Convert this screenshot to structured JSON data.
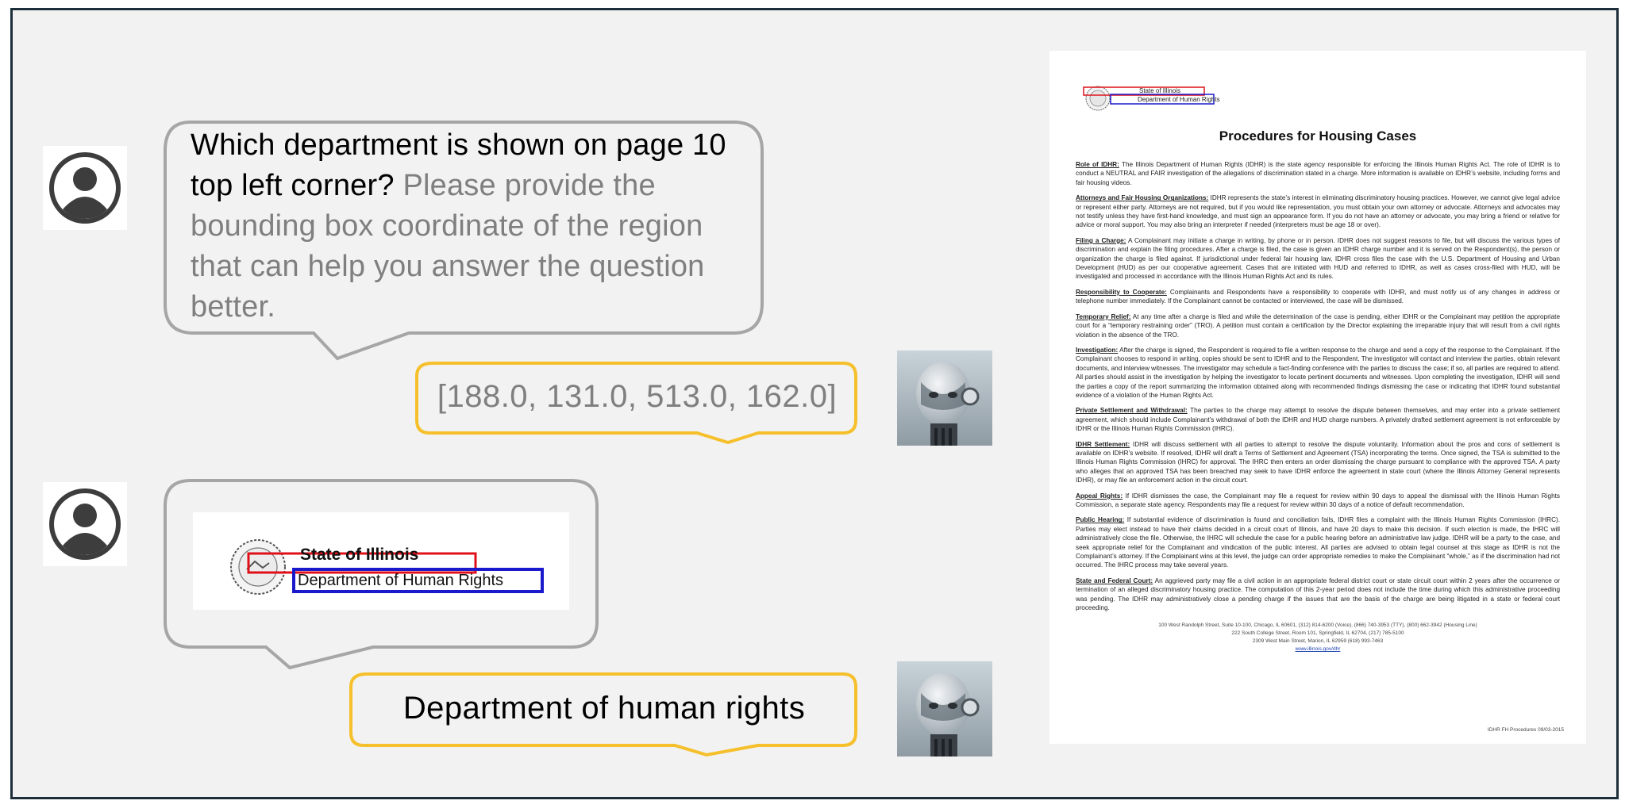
{
  "conversation": {
    "question": {
      "main": "Which department is shown on page 10 top left corner?",
      "hint": "Please provide the bounding box coordinate of the region that can help you answer the question better."
    },
    "bbox_answer": "[188.0, 131.0, 513.0, 162.0]",
    "crop": {
      "line1": "State of Illinois",
      "line2": "Department of Human Rights"
    },
    "final_answer": "Department of human rights"
  },
  "document": {
    "header_state": "State of Illinois",
    "header_dept": "Department of Human Rights",
    "title": "Procedures for Housing Cases",
    "sections": [
      {
        "heading": "Role of IDHR:",
        "text": " The Illinois Department of Human Rights (IDHR) is the state agency responsible for enforcing the Illinois Human Rights Act. The role of IDHR is to conduct a NEUTRAL and FAIR investigation of the allegations of discrimination stated in a charge. More information is available on IDHR’s website, including forms and fair housing videos."
      },
      {
        "heading": "Attorneys and Fair Housing Organizations:",
        "text": " IDHR represents the state’s interest in eliminating discriminatory housing practices. However, we cannot give legal advice or represent either party. Attorneys are not required, but if you would like representation, you must obtain your own attorney or advocate. Attorneys and advocates may not testify unless they have first-hand knowledge, and must sign an appearance form. If you do not have an attorney or advocate, you may bring a friend or relative for advice or moral support. You may also bring an interpreter if needed (interpreters must be age 18 or over)."
      },
      {
        "heading": "Filing a Charge:",
        "text": " A Complainant may initiate a charge in writing, by phone or in person. IDHR does not suggest reasons to file, but will discuss the various types of discrimination and explain the filing procedures. After a charge is filed, the case is given an IDHR charge number and it is served on the Respondent(s), the person or organization the charge is filed against. If jurisdictional under federal fair housing law, IDHR cross files the case with the U.S. Department of Housing and Urban Development (HUD) as per our cooperative agreement. Cases that are initiated with HUD and referred to IDHR, as well as cases cross-filed with HUD, will be investigated and processed in accordance with the Illinois Human Rights Act and its rules."
      },
      {
        "heading": "Responsibility to Cooperate:",
        "text": " Complainants and Respondents have a responsibility to cooperate with IDHR, and must notify us of any changes in address or telephone number immediately. If the Complainant cannot be contacted or interviewed, the case will be dismissed."
      },
      {
        "heading": "Temporary Relief:",
        "text": " At any time after a charge is filed and while the determination of the case is pending, either IDHR or the Complainant may petition the appropriate court for a “temporary restraining order” (TRO). A petition must contain a certification by the Director explaining the irreparable injury that will result from a civil rights violation in the absence of the TRO."
      },
      {
        "heading": "Investigation:",
        "text": " After the charge is signed, the Respondent is required to file a written response to the charge and send a copy of the response to the Complainant. If the Complainant chooses to respond in writing, copies should be sent to IDHR and to the Respondent. The investigator will contact and interview the parties, obtain relevant documents, and interview witnesses. The investigator may schedule a fact-finding conference with the parties to discuss the case; if so, all parties are required to attend. All parties should assist in the investigation by helping the investigator to locate pertinent documents and witnesses. Upon completing the investigation, IDHR will send the parties a copy of the report summarizing the information obtained along with recommended findings dismissing the case or indicating that IDHR found substantial evidence of a violation of the Human Rights Act."
      },
      {
        "heading": "Private Settlement and Withdrawal:",
        "text": " The parties to the charge may attempt to resolve the dispute between themselves, and may enter into a private settlement agreement, which should include Complainant’s withdrawal of both the IDHR and HUD charge numbers. A privately drafted settlement agreement is not enforceable by IDHR or the Illinois Human Rights Commission (IHRC)."
      },
      {
        "heading": "IDHR Settlement:",
        "text": " IDHR will discuss settlement with all parties to attempt to resolve the dispute voluntarily. Information about the pros and cons of settlement is available on IDHR’s website. If resolved, IDHR will draft a Terms of Settlement and Agreement (TSA) incorporating the terms. Once signed, the TSA is submitted to the Illinois Human Rights Commission (IHRC) for approval. The IHRC then enters an order dismissing the charge pursuant to compliance with the approved TSA. A party who alleges that an approved TSA has been breached may seek to have IDHR enforce the agreement in state court (where the Illinois Attorney General represents IDHR), or may file an enforcement action in the circuit court."
      },
      {
        "heading": "Appeal Rights:",
        "text": " If IDHR dismisses the case, the Complainant may file a request for review within 90 days to appeal the dismissal with the Illinois Human Rights Commission, a separate state agency. Respondents may file a request for review within 30 days of a notice of default recommendation."
      },
      {
        "heading": "Public Hearing:",
        "text": " If substantial evidence of discrimination is found and conciliation fails, IDHR files a complaint with the Illinois Human Rights Commission (IHRC). Parties may elect instead to have their claims decided in a circuit court of Illinois, and have 20 days to make this decision. If such election is made, the IHRC will administratively close the file. Otherwise, the IHRC will schedule the case for a public hearing before an administrative law judge. IDHR will be a party to the case, and seek appropriate relief for the Complainant and vindication of the public interest. All parties are advised to obtain legal counsel at this stage as IDHR is not the Complainant’s attorney. If the Complainant wins at this level, the judge can order appropriate remedies to make the Complainant “whole,” as if the discrimination had not occurred. The IHRC process may take several years."
      },
      {
        "heading": "State and Federal Court:",
        "text": " An aggrieved party may file a civil action in an appropriate federal district court or state circuit court within 2 years after the occurrence or termination of an alleged discriminatory housing practice. The computation of this 2-year period does not include the time during which this administrative proceeding was pending. The IDHR may administratively close a pending charge if the issues that are the basis of the charge are being litigated in a state or federal court proceeding."
      }
    ],
    "footer": [
      "100 West Randolph Street, Suite 10-100, Chicago, IL 60601, (312) 814-6200 (Voice), (866) 740-3953 (TTY), (800) 662-3942 (Housing Line)",
      "222 South College Street, Room 101, Springfield, IL 62704, (217) 785-5100",
      "2309 West Main Street, Marion, IL 62959 (618) 993-7463"
    ],
    "footer_link": "www.illinois.gov/dhr",
    "doc_code": "IDHR FH Procedures 09/03-2015"
  },
  "colors": {
    "frame_border": "#1c2f3a",
    "user_bubble_border": "#a6a6a6",
    "bot_bubble_border": "#f5c02c",
    "red_box": "#e0101a",
    "blue_box": "#1a1acc"
  },
  "icons": {
    "user_avatar": "user-avatar-icon",
    "bot_avatar": "robot-avatar-icon"
  }
}
